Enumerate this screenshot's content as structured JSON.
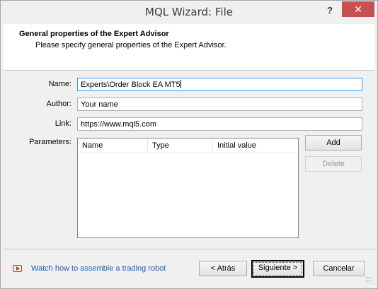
{
  "window": {
    "title": "MQL Wizard: File",
    "help_label": "?",
    "close_label": "✕"
  },
  "header": {
    "title": "General properties of the Expert Advisor",
    "subtitle": "Please specify general properties of the Expert Advisor."
  },
  "form": {
    "name_label": "Name:",
    "name_value": "Experts\\Order Block EA MT5",
    "author_label": "Author:",
    "author_value": "Your name",
    "link_label": "Link:",
    "link_value": "https://www.mql5.com",
    "parameters_label": "Parameters:"
  },
  "parameters_table": {
    "columns": [
      "Name",
      "Type",
      "Initial value"
    ],
    "rows": []
  },
  "buttons": {
    "add": "Add",
    "delete": "Delete",
    "back": "< Atrás",
    "next": "Siguiente >",
    "cancel": "Cancelar"
  },
  "footer": {
    "watch_link": "Watch how to assemble a trading robot"
  },
  "icons": {
    "video": "video-play-icon",
    "help": "help-icon",
    "close": "close-icon"
  },
  "colors": {
    "close_button": "#c75050",
    "link": "#1f5fb0",
    "focus_border": "#3399ff"
  }
}
